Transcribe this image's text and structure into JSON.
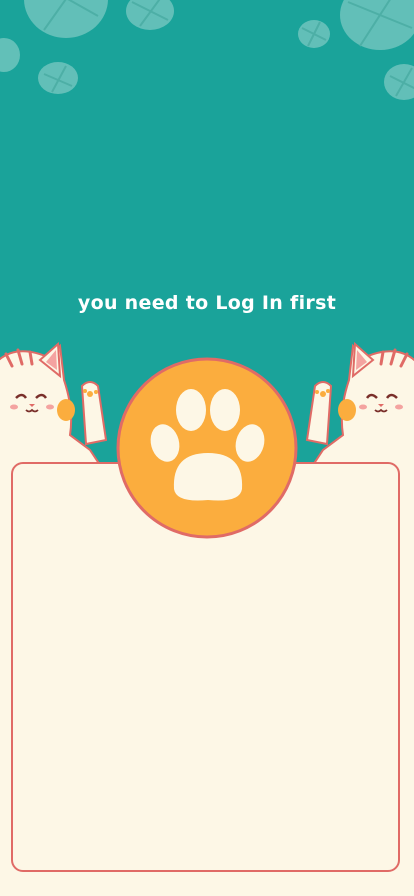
{
  "message": {
    "text": "you need to Log In first"
  },
  "colors": {
    "background": "#1aa39a",
    "bubble": "#7bc9c2",
    "panel": "#fdf7e6",
    "border": "#e06b66",
    "paw_circle": "#fbad3e",
    "paw": "#fdf7e6"
  },
  "icons": {
    "center": "paw-icon",
    "left_cat": "cat-icon",
    "right_cat": "cat-icon"
  }
}
